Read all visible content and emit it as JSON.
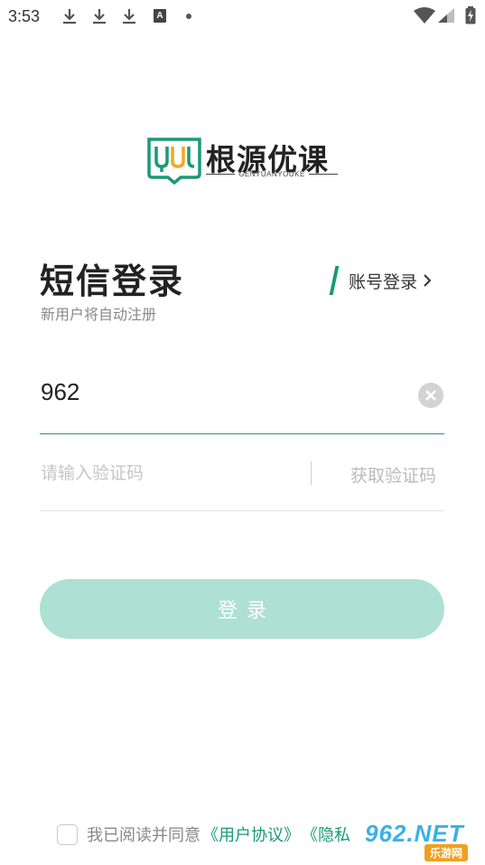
{
  "status_bar": {
    "time": "3:53",
    "icons": [
      "download-icon",
      "download-icon",
      "download-icon",
      "a-notification-icon",
      "dot-icon",
      "wifi-icon",
      "signal-icon",
      "battery-charging-icon"
    ],
    "a_label": "A"
  },
  "logo": {
    "name": "根源优课",
    "subtitle": "GENYUANYOUKE",
    "brand_color": "#1a9a74",
    "accent_color": "#f5a623"
  },
  "heading": {
    "title": "短信登录",
    "subtitle": "新用户将自动注册",
    "switch_label": "账号登录"
  },
  "form": {
    "phone_value": "962",
    "code_placeholder": "请输入验证码",
    "get_code_label": "获取验证码",
    "login_label": "登录"
  },
  "agreement": {
    "prefix": "我已阅读并同意",
    "user_agreement": "《用户协议》",
    "privacy_partial": "《隐私"
  },
  "watermark": {
    "main": "962.NET",
    "sub": "乐游网"
  },
  "colors": {
    "primary": "#1a9a74",
    "button_disabled": "#aee0d4",
    "underline_active": "#2b8c8c"
  }
}
